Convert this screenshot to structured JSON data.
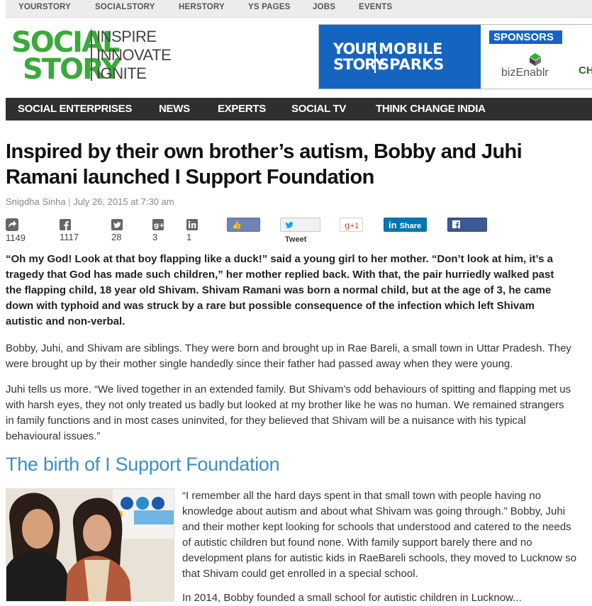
{
  "network_nav": [
    "YOURSTORY",
    "SOCIALSTORY",
    "HERSTORY",
    "YS PAGES",
    "JOBS",
    "EVENTS"
  ],
  "logo": {
    "line1": "SOCIAL",
    "line2": "STORY",
    "tag1": "INSPIRE",
    "tag2": "INNOVATE",
    "tag3": "IGNITE"
  },
  "banner": {
    "ys_line1": "YOUR",
    "ys_line2": "STORY",
    "event_line1": "MOBILE",
    "event_line2": "SPARKS",
    "sponsors": "SPONSORS",
    "sponsor1": "bizEnablr",
    "sponsor2_cut": "CH"
  },
  "main_nav": [
    "SOCIAL ENTERPRISES",
    "NEWS",
    "EXPERTS",
    "SOCIAL TV",
    "THINK CHANGE INDIA"
  ],
  "article": {
    "title": "Inspired by their own brother’s autism, Bobby and Juhi Ramani launched I Support Foundation",
    "author": "Snigdha Sinha",
    "date": "July 26, 2015 at 7:30 am",
    "counts": {
      "share": "1149",
      "facebook": "1117",
      "twitter": "28",
      "gplus": "3",
      "linkedin": "1"
    },
    "buttons": {
      "like": "Like",
      "tweet": "Tweet",
      "gplus": "+1",
      "linkedin": "Share",
      "facebook": "Share"
    },
    "lead": "“Oh my God! Look at that boy flapping like a duck!” said a young girl to her mother. “Don’t look at him, it’s a tragedy that God has made such children,” her mother replied back. With that, the pair hurriedly walked past the flapping child, 18 year old Shivam. Shivam Ramani was born a normal child, but at the age of 3, he came down with typhoid and was struck by a rare but possible consequence of the infection which left Shivam autistic and non-verbal.",
    "p1": "Bobby, Juhi, and Shivam are siblings. They were born and brought up in Rae Bareli, a small town in Uttar Pradesh. They were brought up by their mother single handedly since their father had passed away when they were young.",
    "p2": "Juhi tells us more. “We lived together in an extended family. But Shivam’s odd behaviours of spitting and flapping met us with harsh eyes, they not only treated us badly but looked at my brother like he was no human. We remained strangers in family functions and in most cases uninvited, for they believed that Shivam will be a nuisance with his typical behavioural issues.”",
    "subheading": "The birth of I Support Foundation",
    "p3": "“I remember all the hard days spent in that small town with people having no knowledge about autism and about what Shivam was going through.” Bobby, Juhi and their mother kept looking for schools that understood and catered to the needs of autistic children but found none. With family support barely there and no development plans for autistic kids in RaeBareli schools, they moved to Lucknow so that Shivam could get enrolled in a special school.",
    "p4_cut": "In 2014, Bobby founded a small school for autistic children in Lucknow..."
  },
  "colors": {
    "brand_green": "#3aaa3a",
    "nav_dark": "#2f2f2f",
    "subheading_blue": "#3a8fc9",
    "banner_blue": "#1565c0"
  }
}
